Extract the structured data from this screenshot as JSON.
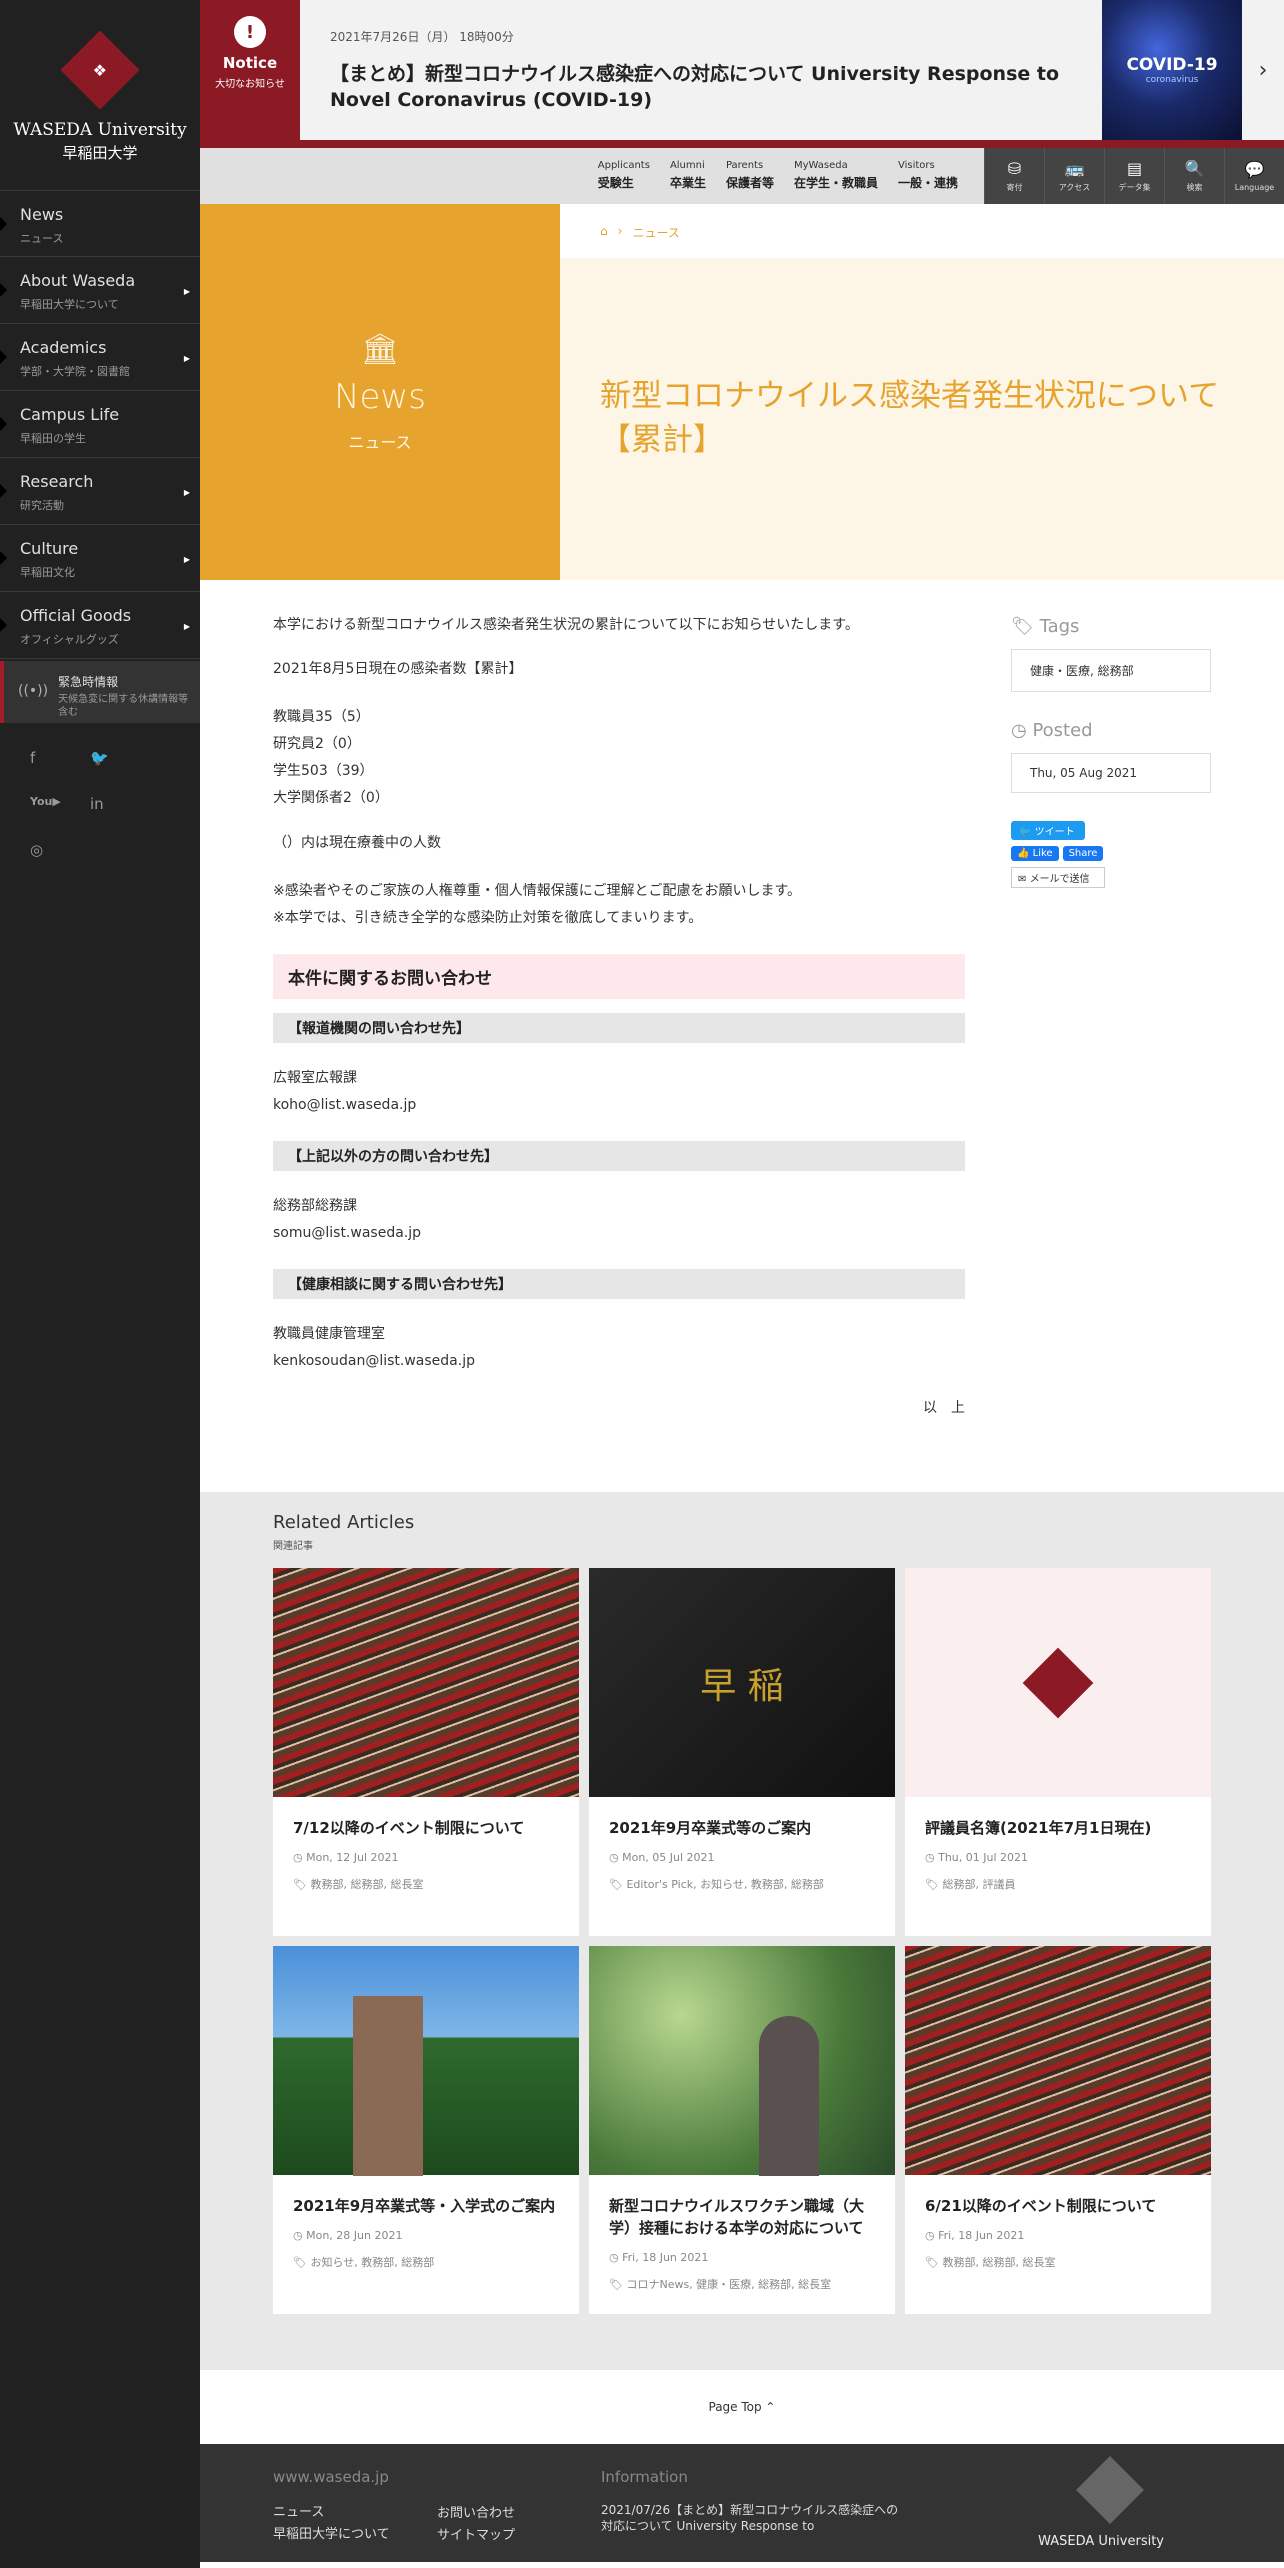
{
  "logo": {
    "name": "WASEDA University",
    "jp": "早稲田大学"
  },
  "sidebar": {
    "items": [
      {
        "en": "News",
        "jp": "ニュース",
        "arrow": false
      },
      {
        "en": "About Waseda",
        "jp": "早稲田大学について",
        "arrow": true
      },
      {
        "en": "Academics",
        "jp": "学部・大学院・図書館",
        "arrow": true
      },
      {
        "en": "Campus Life",
        "jp": "早稲田の学生",
        "arrow": false
      },
      {
        "en": "Research",
        "jp": "研究活動",
        "arrow": true
      },
      {
        "en": "Culture",
        "jp": "早稲田文化",
        "arrow": true
      },
      {
        "en": "Official Goods",
        "jp": "オフィシャルグッズ",
        "arrow": true
      }
    ],
    "emergency": {
      "title": "緊急時情報",
      "desc": "天候急変に関する休講情報等含む"
    },
    "social": [
      "facebook-icon",
      "twitter-icon",
      "youtube-icon",
      "linkedin-icon",
      "instagram-icon"
    ]
  },
  "notice": {
    "badge": "Notice",
    "badge_jp": "大切なお知らせ",
    "date": "2021年7月26日（月） 18時00分",
    "title": "【まとめ】新型コロナウイルス感染症への対応について University Response to Novel Coronavirus (COVID-19)",
    "image_title": "COVID-19",
    "image_sub": "coronavirus"
  },
  "toolbar": {
    "links": [
      {
        "en": "Applicants",
        "jp": "受験生"
      },
      {
        "en": "Alumni",
        "jp": "卒業生"
      },
      {
        "en": "Parents",
        "jp": "保護者等"
      },
      {
        "en": "MyWaseda",
        "jp": "在学生・教職員"
      },
      {
        "en": "Visitors",
        "jp": "一般・連携"
      }
    ],
    "icons": [
      {
        "label": "寄付",
        "icon": "donation-icon"
      },
      {
        "label": "アクセス",
        "icon": "bus-icon"
      },
      {
        "label": "データ集",
        "icon": "book-icon"
      },
      {
        "label": "検索",
        "icon": "search-icon"
      },
      {
        "label": "Language",
        "icon": "language-icon"
      }
    ]
  },
  "hero": {
    "en": "News",
    "jp": "ニュース",
    "breadcrumb": "ニュース",
    "title": "新型コロナウイルス感染者発生状況について【累計】"
  },
  "article": {
    "intro": "本学における新型コロナウイルス感染者発生状況の累計について以下にお知らせいたします。",
    "as_of": "2021年8月5日現在の感染者数【累計】",
    "counts": [
      "教職員35（5）",
      "研究員2（0）",
      "学生503（39）",
      "大学関係者2（0）"
    ],
    "note": "（）内は現在療養中の人数",
    "requests": [
      "※感染者やそのご家族の人権尊重・個人情報保護にご理解とご配慮をお願いします。",
      "※本学では、引き続き全学的な感染防止対策を徹底してまいります。"
    ],
    "inquiry_heading": "本件に関するお問い合わせ",
    "contacts": [
      {
        "heading": "【報道機関の問い合わせ先】",
        "name": "広報室広報課",
        "email": "koho@list.waseda.jp"
      },
      {
        "heading": "【上記以外の方の問い合わせ先】",
        "name": "総務部総務課",
        "email": "somu@list.waseda.jp"
      },
      {
        "heading": "【健康相談に関する問い合わせ先】",
        "name": "教職員健康管理室",
        "email": "kenkosoudan@list.waseda.jp"
      }
    ],
    "end": "以　上"
  },
  "side": {
    "tags_heading": "Tags",
    "tags": "健康・医療, 総務部",
    "posted_heading": "Posted",
    "posted": "Thu, 05 Aug 2021",
    "tweet": "ツイート",
    "like": "Like",
    "share": "Share",
    "mail": "メールで送信"
  },
  "related": {
    "heading": "Related Articles",
    "heading_jp": "関連記事",
    "cards": [
      {
        "title": "7/12以降のイベント制限について",
        "date": "Mon, 12 Jul 2021",
        "tags": "教務部, 総務部, 総長室",
        "image": "hall"
      },
      {
        "title": "2021年9月卒業式等のご案内",
        "date": "Mon, 05 Jul 2021",
        "tags": "Editor's Pick, お知らせ, 教務部, 総務部",
        "image": "book"
      },
      {
        "title": "評議員名簿(2021年7月1日現在)",
        "date": "Thu, 01 Jul 2021",
        "tags": "総務部, 評議員",
        "image": "logo"
      },
      {
        "title": "2021年9月卒業式等・入学式のご案内",
        "date": "Mon, 28 Jun 2021",
        "tags": "お知らせ, 教務部, 総務部",
        "image": "tower"
      },
      {
        "title": "新型コロナウイルスワクチン職域（大学）接種における本学の対応について",
        "date": "Fri, 18 Jun 2021",
        "tags": "コロナNews, 健康・医療, 総務部, 総長室",
        "image": "statue"
      },
      {
        "title": "6/21以降のイベント制限について",
        "date": "Fri, 18 Jun 2021",
        "tags": "教務部, 総務部, 総長室",
        "image": "hall"
      }
    ]
  },
  "page_top": "Page Top ⌃",
  "footer": {
    "site": "www.waseda.jp",
    "links1": [
      "ニュース",
      "早稲田大学について"
    ],
    "links2": [
      "お問い合わせ",
      "サイトマップ"
    ],
    "info_heading": "Information",
    "info_text": "2021/07/26【まとめ】新型コロナウイルス感染症への対応について University Response to",
    "logo_text": "WASEDA University"
  }
}
